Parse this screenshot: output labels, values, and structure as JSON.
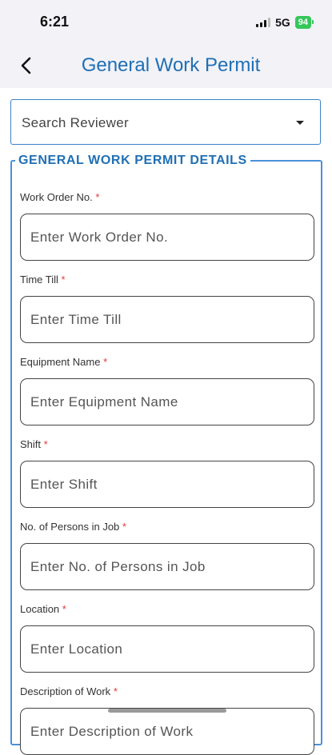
{
  "status_bar": {
    "time": "6:21",
    "network": "5G",
    "battery": "94"
  },
  "nav": {
    "title": "General Work Permit"
  },
  "reviewer_select": {
    "placeholder": "Search Reviewer"
  },
  "section": {
    "legend": "GENERAL WORK PERMIT DETAILS",
    "required_mark": "*",
    "fields": [
      {
        "label": "Work Order No.",
        "placeholder": "Enter Work Order No."
      },
      {
        "label": "Time Till",
        "placeholder": "Enter Time Till"
      },
      {
        "label": "Equipment Name",
        "placeholder": "Enter Equipment Name"
      },
      {
        "label": "Shift",
        "placeholder": "Enter Shift"
      },
      {
        "label": "No. of Persons in Job",
        "placeholder": "Enter No. of Persons in Job"
      },
      {
        "label": "Location",
        "placeholder": "Enter Location"
      },
      {
        "label": "Description of Work",
        "placeholder": "Enter Description of Work"
      }
    ]
  },
  "colors": {
    "accent": "#1f6fb5",
    "border": "#4a90d9",
    "required": "#e53935",
    "battery": "#34c759"
  }
}
